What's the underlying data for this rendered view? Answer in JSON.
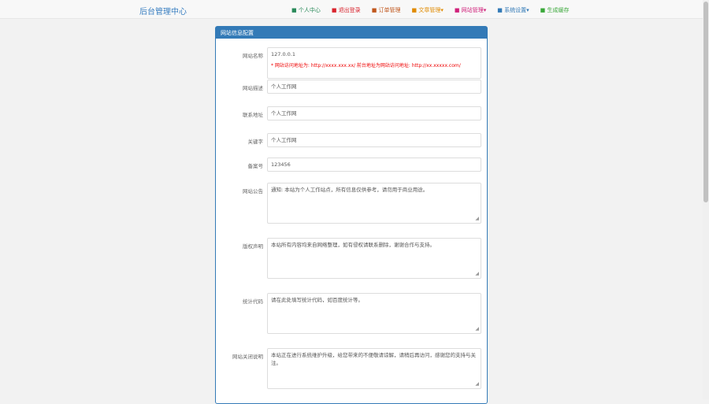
{
  "header": {
    "brand": "后台管理中心",
    "menu": [
      {
        "label": "个人中心",
        "color": "#2a8a5a",
        "icon": "user-icon"
      },
      {
        "label": "退出登录",
        "color": "#d9232d",
        "icon": "power-icon"
      },
      {
        "label": "订单管理",
        "color": "#c0561c",
        "icon": "order-icon"
      },
      {
        "label": "文章管理▾",
        "color": "#e08a00",
        "icon": "doc-icon"
      },
      {
        "label": "网站管理▾",
        "color": "#d0207a",
        "icon": "site-icon"
      },
      {
        "label": "系统设置▾",
        "color": "#337ab7",
        "icon": "gear-icon"
      },
      {
        "label": "生成缓存",
        "color": "#3aa83a",
        "icon": "refresh-icon"
      }
    ]
  },
  "panel": {
    "title": "网站信息配置",
    "fields": [
      {
        "label": "网站名称",
        "value": "127.0.0.1",
        "note": "* 网站访问地址为: http://xxxx.xxx.xx/ 前台地址为网站访问地址: http://xx.xxxxx.com/"
      },
      {
        "label": "网站描述",
        "value": "个人工作网"
      },
      {
        "label": "联系地址",
        "value": "个人工作网"
      },
      {
        "label": "关键字",
        "value": "个人工作网"
      },
      {
        "label": "备案号",
        "value": "123456"
      },
      {
        "label": "网站公告",
        "value": "通知: 本站为个人工作站点，所有信息仅供参考，请勿用于商业用途。"
      },
      {
        "label": "版权声明",
        "value": "本站所有内容均来自网络整理，如有侵权请联系删除，谢谢合作与支持。"
      },
      {
        "label": "统计代码",
        "value": "请在此处填写统计代码，如百度统计等。"
      },
      {
        "label": "网站关闭说明",
        "value": "本站正在进行系统维护升级，给您带来的不便敬请谅解，请稍后再访问，感谢您的支持与关注。"
      }
    ]
  }
}
